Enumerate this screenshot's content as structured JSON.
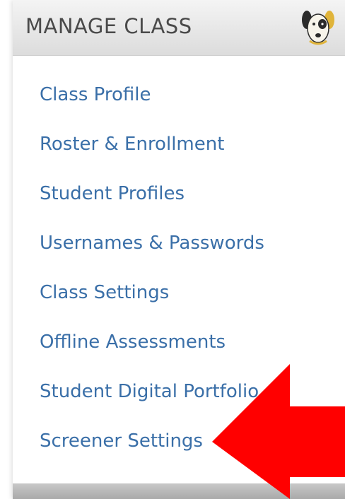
{
  "header": {
    "title": "MANAGE CLASS",
    "mascot_icon": "dog-mascot-icon"
  },
  "menu": {
    "items": [
      {
        "label": "Class Profile"
      },
      {
        "label": "Roster & Enrollment"
      },
      {
        "label": "Student Profiles"
      },
      {
        "label": "Usernames & Passwords"
      },
      {
        "label": "Class Settings"
      },
      {
        "label": "Offline Assessments"
      },
      {
        "label": "Student Digital Portfolio"
      },
      {
        "label": "Screener Settings"
      }
    ]
  },
  "annotation": {
    "arrow_icon": "red-arrow-icon",
    "arrow_color": "#ff0000"
  },
  "colors": {
    "link": "#3a6fa8",
    "title": "#4a4a4a"
  }
}
